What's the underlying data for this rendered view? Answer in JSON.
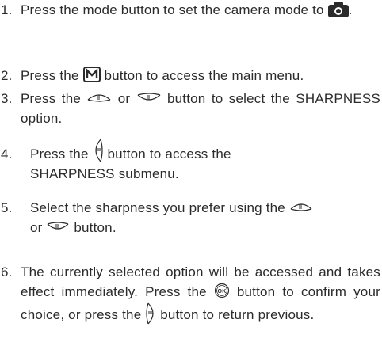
{
  "steps": [
    {
      "num": "1.",
      "parts": [
        "Press the mode button to set the camera mode to ",
        "."
      ],
      "icons": [
        "camera-icon"
      ]
    },
    {
      "num": "2.",
      "parts": [
        "Press the ",
        " button to access the main menu."
      ],
      "icons": [
        "menu-m-icon"
      ]
    },
    {
      "num": "3.",
      "parts": [
        "Press the ",
        " or ",
        " button to select the SHARPNESS option."
      ],
      "icons": [
        "nav-up-button-icon",
        "nav-down-button-icon"
      ]
    },
    {
      "num": "4.",
      "parts": [
        "Press the ",
        " button to access the",
        "SHARPNESS submenu."
      ],
      "icons": [
        "nav-right-button-icon"
      ]
    },
    {
      "num": "5.",
      "parts": [
        "Select the sharpness you prefer using the ",
        "or ",
        " button."
      ],
      "icons": [
        "nav-up-button-icon",
        "nav-down-button-icon"
      ]
    },
    {
      "num": "6.",
      "parts": [
        "The currently selected option will be accessed and takes effect immediately. Press the ",
        " button to confirm your choice, or press the ",
        " button to return previous."
      ],
      "icons": [
        "ok-button-icon",
        "nav-left-button-icon"
      ]
    }
  ]
}
